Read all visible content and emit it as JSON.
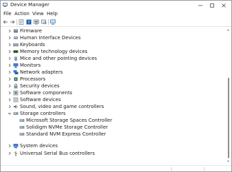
{
  "window": {
    "title": "Device Manager",
    "accent_color": "#0a5fb4"
  },
  "menu": {
    "items": [
      "File",
      "Action",
      "View",
      "Help"
    ]
  },
  "toolbar": {
    "buttons": [
      "back-arrow-icon",
      "forward-arrow-icon",
      "properties-icon",
      "help-icon",
      "update-driver-icon",
      "scan-hardware-icon",
      "monitor-icon"
    ]
  },
  "tree": {
    "categories": [
      {
        "label": "Firmware",
        "icon": "firmware-icon",
        "expanded": false
      },
      {
        "label": "Human Interface Devices",
        "icon": "hid-icon",
        "expanded": false
      },
      {
        "label": "Keyboards",
        "icon": "keyboard-icon",
        "expanded": false
      },
      {
        "label": "Memory technology devices",
        "icon": "memory-icon",
        "expanded": false
      },
      {
        "label": "Mice and other pointing devices",
        "icon": "mouse-icon",
        "expanded": false
      },
      {
        "label": "Monitors",
        "icon": "monitor-icon",
        "expanded": false
      },
      {
        "label": "Network adapters",
        "icon": "network-icon",
        "expanded": false
      },
      {
        "label": "Processors",
        "icon": "processor-icon",
        "expanded": false
      },
      {
        "label": "Security devices",
        "icon": "security-icon",
        "expanded": false
      },
      {
        "label": "Software components",
        "icon": "software-component-icon",
        "expanded": false
      },
      {
        "label": "Software devices",
        "icon": "software-device-icon",
        "expanded": false
      },
      {
        "label": "Sound, video and game controllers",
        "icon": "sound-icon",
        "expanded": false
      },
      {
        "label": "Storage controllers",
        "icon": "storage-controller-icon",
        "expanded": true,
        "children": [
          {
            "label": "Microsoft Storage Spaces Controller",
            "icon": "storage-device-icon"
          },
          {
            "label": "Solidigm NVMe Storage Controller",
            "icon": "storage-device-icon"
          },
          {
            "label": "Standard NVM Express Controller",
            "icon": "storage-device-icon"
          }
        ]
      },
      {
        "label": "System devices",
        "icon": "system-device-icon",
        "expanded": false
      },
      {
        "label": "Universal Serial Bus controllers",
        "icon": "usb-icon",
        "expanded": false
      }
    ]
  }
}
